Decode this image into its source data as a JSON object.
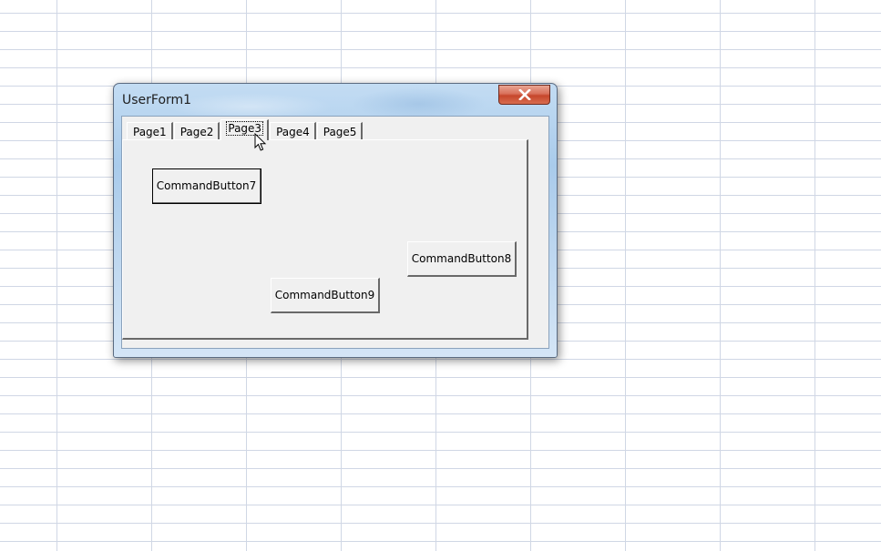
{
  "window": {
    "title": "UserForm1",
    "close_glyph": "✕"
  },
  "multipage": {
    "tabs": [
      {
        "label": "Page1",
        "selected": false
      },
      {
        "label": "Page2",
        "selected": false
      },
      {
        "label": "Page3",
        "selected": true
      },
      {
        "label": "Page4",
        "selected": false
      },
      {
        "label": "Page5",
        "selected": false
      }
    ]
  },
  "buttons": {
    "cb7": "CommandButton7",
    "cb8": "CommandButton8",
    "cb9": "CommandButton9"
  },
  "icons": {
    "close": "close-icon",
    "cursor": "mouse-pointer-icon"
  },
  "colors": {
    "dialog_face": "#f0f0f0",
    "close_red": "#c6462b",
    "title_glass": "#a9cbeb",
    "grid_line": "#d0d7e5"
  }
}
